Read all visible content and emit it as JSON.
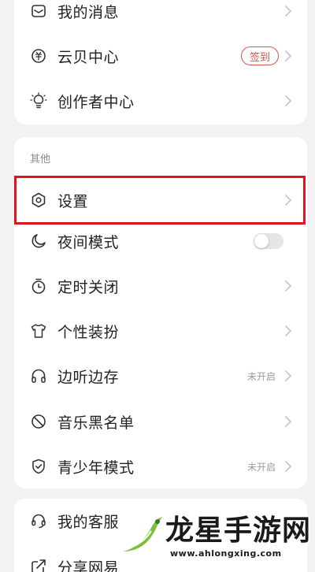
{
  "top_menu": {
    "items": [
      {
        "label": "我的消息",
        "icon": "mail-icon"
      },
      {
        "label": "云贝中心",
        "icon": "coin-icon",
        "badge": "签到"
      },
      {
        "label": "创作者中心",
        "icon": "lightbulb-icon"
      }
    ]
  },
  "other_section": {
    "title": "其他",
    "items": [
      {
        "label": "设置",
        "icon": "settings-hexagon-icon"
      },
      {
        "label": "夜间模式",
        "icon": "moon-icon",
        "toggle_on": false
      },
      {
        "label": "定时关闭",
        "icon": "timer-icon"
      },
      {
        "label": "个性装扮",
        "icon": "tshirt-icon"
      },
      {
        "label": "边听边存",
        "icon": "headphones-icon",
        "status": "未开启"
      },
      {
        "label": "音乐黑名单",
        "icon": "blocked-icon"
      },
      {
        "label": "青少年模式",
        "icon": "shield-check-icon",
        "status": "未开启"
      }
    ]
  },
  "bottom_menu": {
    "items": [
      {
        "label": "我的客服",
        "icon": "headset-icon"
      },
      {
        "label": "分享网易",
        "icon": "share-icon"
      }
    ]
  },
  "watermark": {
    "title": "龙星手游网",
    "url": "www.ahlongxing.com"
  },
  "colors": {
    "background": "#f2f2f4",
    "card": "#ffffff",
    "highlight_border": "#e0141f",
    "badge": "#d9534f"
  }
}
